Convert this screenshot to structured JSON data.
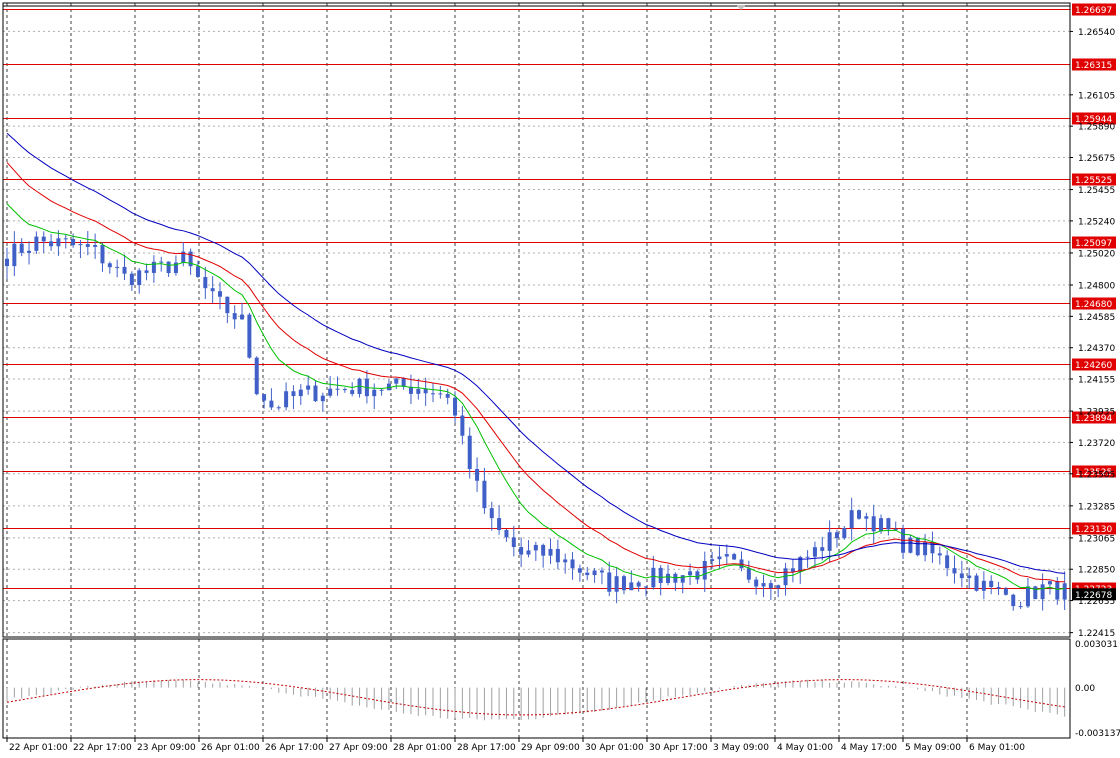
{
  "colors": {
    "candle": "#4060c8",
    "ma_fast": "#00c000",
    "ma_mid": "#e00000",
    "ma_slow": "#0000c0",
    "level_line": "#e00000",
    "level_label_bg": "#e00000",
    "grid": "#808080",
    "oscillator": "#c00000",
    "current_price_bg": "#000000"
  },
  "chart_data": [
    {
      "type": "candlestick",
      "symbol_panel": "price",
      "ylim": [
        1.22385,
        1.26735
      ],
      "price_ticks": [
        "1.26540",
        "1.26105",
        "1.25890",
        "1.25675",
        "1.25455",
        "1.25240",
        "1.25020",
        "1.24800",
        "1.24585",
        "1.24370",
        "1.24155",
        "1.23935",
        "1.23720",
        "1.23505",
        "1.23285",
        "1.23065",
        "1.22850",
        "1.22635",
        "1.22415"
      ],
      "horizontal_levels": [
        "1.26697",
        "1.26315",
        "1.25944",
        "1.25525",
        "1.25097",
        "1.24680",
        "1.24260",
        "1.23894",
        "1.23525",
        "1.23130",
        "1.22723"
      ],
      "current_price": "1.22678",
      "x_labels": [
        "22 Apr 01:00",
        "22 Apr 17:00",
        "23 Apr 09:00",
        "26 Apr 01:00",
        "26 Apr 17:00",
        "27 Apr 09:00",
        "28 Apr 01:00",
        "28 Apr 17:00",
        "29 Apr 09:00",
        "30 Apr 01:00",
        "30 Apr 17:00",
        "3 May 09:00",
        "4 May 01:00",
        "4 May 17:00",
        "5 May 09:00",
        "6 May 01:00"
      ],
      "close_path": [
        [
          0,
          1.25
        ],
        [
          4,
          1.251
        ],
        [
          8,
          1.2508
        ],
        [
          12,
          1.2503
        ],
        [
          16,
          1.2485
        ],
        [
          20,
          1.249
        ],
        [
          24,
          1.2497
        ],
        [
          28,
          1.247
        ],
        [
          32,
          1.2455
        ],
        [
          34,
          1.241
        ],
        [
          36,
          1.2397
        ],
        [
          40,
          1.2405
        ],
        [
          44,
          1.2408
        ],
        [
          48,
          1.241
        ],
        [
          52,
          1.241
        ],
        [
          56,
          1.241
        ],
        [
          60,
          1.2405
        ],
        [
          62,
          1.2375
        ],
        [
          64,
          1.234
        ],
        [
          66,
          1.2315
        ],
        [
          70,
          1.2295
        ],
        [
          74,
          1.2296
        ],
        [
          78,
          1.2285
        ],
        [
          82,
          1.2275
        ],
        [
          86,
          1.2278
        ],
        [
          90,
          1.228
        ],
        [
          94,
          1.2283
        ],
        [
          98,
          1.229
        ],
        [
          100,
          1.2282
        ],
        [
          104,
          1.2278
        ],
        [
          108,
          1.229
        ],
        [
          112,
          1.2305
        ],
        [
          116,
          1.2325
        ],
        [
          118,
          1.2318
        ],
        [
          122,
          1.2303
        ],
        [
          126,
          1.2295
        ],
        [
          130,
          1.2283
        ],
        [
          134,
          1.227
        ],
        [
          138,
          1.2265
        ],
        [
          141,
          1.2272
        ],
        [
          144,
          1.227
        ]
      ],
      "sma_fast_start": 1.2545,
      "sma_mid_start": 1.2572,
      "sma_slow_start": 1.259
    },
    {
      "type": "histogram",
      "symbol_panel": "oscillator",
      "ylim": [
        -0.003137,
        0.003031
      ],
      "ticks": [
        "0.003031",
        "0.00",
        "-0.003137"
      ]
    }
  ]
}
